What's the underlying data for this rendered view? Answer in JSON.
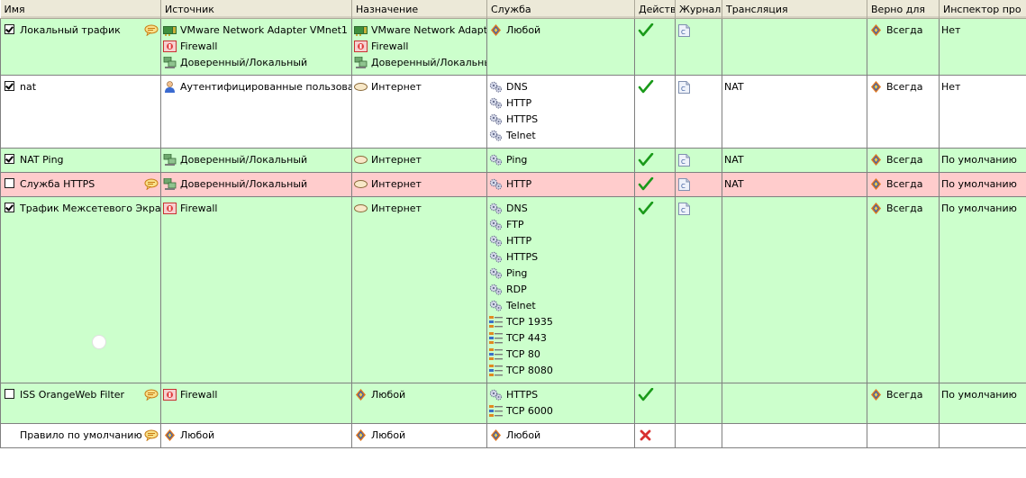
{
  "columns": [
    "Имя",
    "Источник",
    "Назначение",
    "Служба",
    "Действ",
    "Журнал",
    "Трансляция",
    "Верно для",
    "Инспектор про"
  ],
  "rules": [
    {
      "name": "Локальный трафик",
      "checked": true,
      "checkbox": true,
      "comment": true,
      "bg": "green",
      "source": [
        {
          "icon": "network-adapter",
          "text": "VMware Network Adapter VMnet1"
        },
        {
          "icon": "firewall",
          "text": "Firewall"
        },
        {
          "icon": "network",
          "text": "Доверенный/Локальный"
        }
      ],
      "destination": [
        {
          "icon": "network-adapter",
          "text": "VMware Network Adapter"
        },
        {
          "icon": "firewall",
          "text": "Firewall"
        },
        {
          "icon": "network",
          "text": "Доверенный/Локальный"
        }
      ],
      "service": [
        {
          "icon": "any",
          "text": "Любой"
        }
      ],
      "action": "allow",
      "log": true,
      "translation": "",
      "applies_to": "Всегда",
      "inspector": "Нет",
      "lines": 3
    },
    {
      "name": "nat",
      "checked": true,
      "checkbox": true,
      "comment": false,
      "bg": "white",
      "source": [
        {
          "icon": "user",
          "text": "Аутентифицированные пользователи"
        }
      ],
      "destination": [
        {
          "icon": "cloud",
          "text": "Интернет"
        }
      ],
      "service": [
        {
          "icon": "gears",
          "text": "DNS"
        },
        {
          "icon": "gears",
          "text": "HTTP"
        },
        {
          "icon": "gears",
          "text": "HTTPS"
        },
        {
          "icon": "gears",
          "text": "Telnet"
        }
      ],
      "action": "allow",
      "log": true,
      "translation": "NAT",
      "applies_to": "Всегда",
      "inspector": "Нет",
      "lines": 4
    },
    {
      "name": "NAT Ping",
      "checked": true,
      "checkbox": true,
      "comment": false,
      "bg": "green",
      "source": [
        {
          "icon": "network",
          "text": "Доверенный/Локальный"
        }
      ],
      "destination": [
        {
          "icon": "cloud",
          "text": "Интернет"
        }
      ],
      "service": [
        {
          "icon": "gears",
          "text": "Ping"
        }
      ],
      "action": "allow",
      "log": true,
      "translation": "NAT",
      "applies_to": "Всегда",
      "inspector": "По умолчанию",
      "lines": 1
    },
    {
      "name": "Служба HTTPS",
      "checked": false,
      "checkbox": true,
      "comment": true,
      "bg": "red",
      "source": [
        {
          "icon": "network",
          "text": "Доверенный/Локальный"
        }
      ],
      "destination": [
        {
          "icon": "cloud",
          "text": "Интернет"
        }
      ],
      "service": [
        {
          "icon": "gears",
          "text": "HTTP"
        }
      ],
      "action": "allow",
      "log": true,
      "translation": "NAT",
      "applies_to": "Всегда",
      "inspector": "По умолчанию",
      "lines": 1
    },
    {
      "name": "Трафик Межсетевого Экрана",
      "checked": true,
      "checkbox": true,
      "comment": false,
      "bg": "green",
      "source": [
        {
          "icon": "firewall",
          "text": "Firewall"
        }
      ],
      "destination": [
        {
          "icon": "cloud",
          "text": "Интернет"
        }
      ],
      "service": [
        {
          "icon": "gears",
          "text": "DNS"
        },
        {
          "icon": "gears",
          "text": "FTP"
        },
        {
          "icon": "gears",
          "text": "HTTP"
        },
        {
          "icon": "gears",
          "text": "HTTPS"
        },
        {
          "icon": "gears",
          "text": "Ping"
        },
        {
          "icon": "gears",
          "text": "RDP"
        },
        {
          "icon": "gears",
          "text": "Telnet"
        },
        {
          "icon": "port",
          "text": "TCP 1935"
        },
        {
          "icon": "port",
          "text": "TCP 443"
        },
        {
          "icon": "port",
          "text": "TCP 80"
        },
        {
          "icon": "port",
          "text": "TCP 8080"
        }
      ],
      "action": "allow",
      "log": true,
      "translation": "",
      "applies_to": "Всегда",
      "inspector": "По умолчанию",
      "lines": 11
    },
    {
      "name": "ISS OrangeWeb Filter",
      "checked": false,
      "checkbox": true,
      "comment": true,
      "bg": "green",
      "source": [
        {
          "icon": "firewall",
          "text": "Firewall"
        }
      ],
      "destination": [
        {
          "icon": "any",
          "text": "Любой"
        }
      ],
      "service": [
        {
          "icon": "gears",
          "text": "HTTPS"
        },
        {
          "icon": "port",
          "text": "TCP 6000"
        }
      ],
      "action": "allow",
      "log": false,
      "translation": "",
      "applies_to": "Всегда",
      "inspector": "По умолчанию",
      "lines": 2
    },
    {
      "name": "Правило по умолчанию",
      "checked": false,
      "checkbox": false,
      "comment": true,
      "bg": "white",
      "source": [
        {
          "icon": "any",
          "text": "Любой"
        }
      ],
      "destination": [
        {
          "icon": "any",
          "text": "Любой"
        }
      ],
      "service": [
        {
          "icon": "any",
          "text": "Любой"
        }
      ],
      "action": "deny",
      "log": false,
      "translation": "",
      "applies_to": "",
      "inspector": "",
      "lines": 1
    }
  ],
  "colors": {
    "allowed_row": "#ccffcc",
    "disabled_row": "#ffcccc",
    "header_bg": "#ece9d8"
  }
}
